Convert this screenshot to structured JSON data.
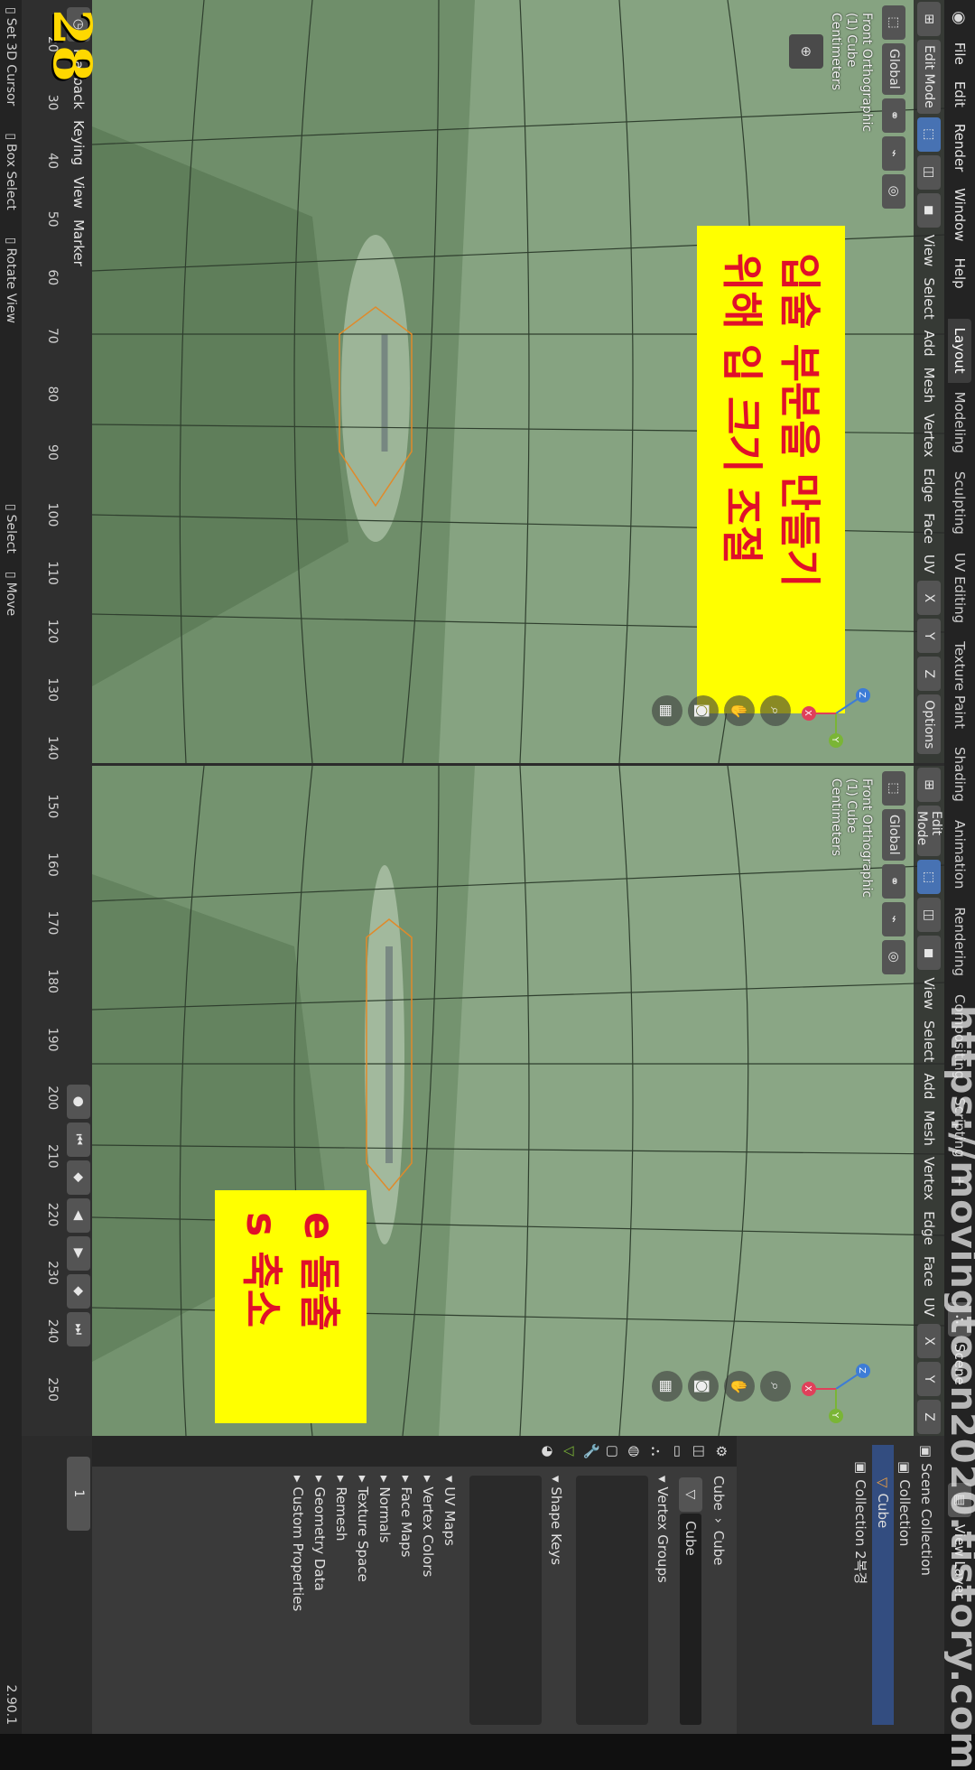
{
  "app": {
    "menu": [
      "File",
      "Edit",
      "Render",
      "Window",
      "Help"
    ],
    "workspaces": [
      "Layout",
      "Modeling",
      "Sculpting",
      "UV Editing",
      "Texture Paint",
      "Shading",
      "Animation",
      "Rendering",
      "Compositing",
      "Scripting"
    ],
    "active_workspace": "Layout",
    "add_workspace": "+",
    "scene": "Scene",
    "view_layer": "View Layer",
    "watermark": "https://movingtoon2020.tistory.com"
  },
  "viewport_header": {
    "mode": "Edit Mode",
    "orientation": "Global",
    "menus": [
      "View",
      "Select",
      "Add",
      "Mesh",
      "Vertex",
      "Edge",
      "Face",
      "UV"
    ],
    "axes": [
      "X",
      "Y",
      "Z"
    ],
    "options": "Options"
  },
  "viewports": [
    {
      "overlay": [
        "Front Orthographic",
        "(1) Cube",
        "Centimeters"
      ],
      "banner": [
        "입술 부분을 만들기",
        "위해 입 크기 조절"
      ]
    },
    {
      "overlay": [
        "Front Orthographic",
        "(1) Cube",
        "Centimeters"
      ],
      "banner": [
        "e 돌출",
        "s 축소"
      ]
    }
  ],
  "gizmo": {
    "z": "Z",
    "y": "Y",
    "x": "X"
  },
  "outliner": {
    "scene_collection": "Scene Collection",
    "collection": "Collection",
    "cube": "Cube",
    "collection2": "Collection 2복경"
  },
  "properties": {
    "breadcrumb": [
      "Cube",
      "Cube"
    ],
    "mesh_name": "Cube",
    "panels": [
      "Vertex Groups",
      "Shape Keys",
      "UV Maps",
      "Vertex Colors",
      "Face Maps",
      "Normals",
      "Texture Space",
      "Remesh",
      "Geometry Data",
      "Custom Properties"
    ]
  },
  "timeline": {
    "menus": [
      "Playback",
      "Keying",
      "View",
      "Marker"
    ],
    "ticks": [
      "20",
      "30",
      "40",
      "50",
      "60",
      "70",
      "80",
      "90",
      "100",
      "110",
      "120",
      "130",
      "140",
      "150",
      "160",
      "170",
      "180",
      "190",
      "200",
      "210",
      "220",
      "230",
      "240",
      "250"
    ],
    "current_frame": "1",
    "frame_number": "28"
  },
  "status": {
    "items": [
      "Set 3D Cursor",
      "Box Select",
      "Rotate View",
      "Select",
      "Move"
    ],
    "version": "2.90.1"
  },
  "colors": {
    "banner_bg": "#ffff00",
    "banner_text": "#e0102a",
    "mesh": "#7e9b78",
    "select": "#4772b3"
  }
}
